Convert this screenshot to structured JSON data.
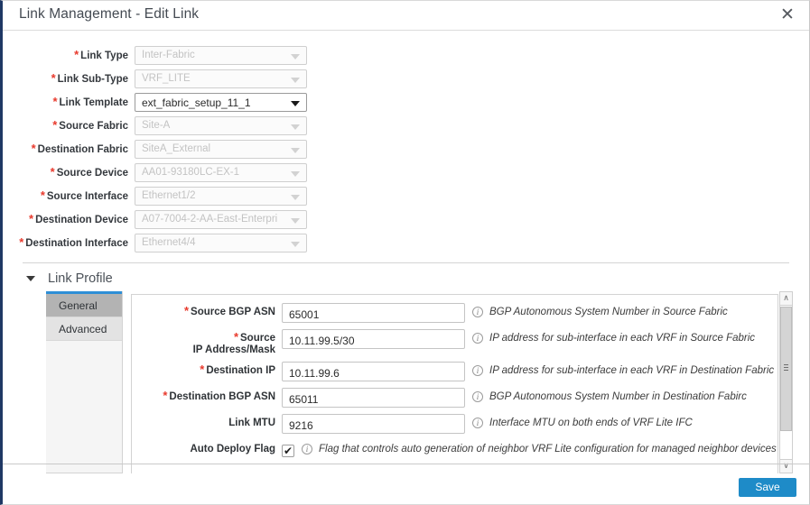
{
  "header": {
    "title": "Link Management - Edit Link",
    "close_label": "✕"
  },
  "top_form": {
    "fields": [
      {
        "label": "Link Type",
        "value": "Inter-Fabric",
        "required": true,
        "enabled": false
      },
      {
        "label": "Link Sub-Type",
        "value": "VRF_LITE",
        "required": true,
        "enabled": false
      },
      {
        "label": "Link Template",
        "value": "ext_fabric_setup_11_1",
        "required": true,
        "enabled": true
      },
      {
        "label": "Source Fabric",
        "value": "Site-A",
        "required": true,
        "enabled": false
      },
      {
        "label": "Destination Fabric",
        "value": "SiteA_External",
        "required": true,
        "enabled": false
      },
      {
        "label": "Source Device",
        "value": "AA01-93180LC-EX-1",
        "required": true,
        "enabled": false
      },
      {
        "label": "Source Interface",
        "value": "Ethernet1/2",
        "required": true,
        "enabled": false
      },
      {
        "label": "Destination Device",
        "value": "A07-7004-2-AA-East-Enterpri",
        "required": true,
        "enabled": false
      },
      {
        "label": "Destination Interface",
        "value": "Ethernet4/4",
        "required": true,
        "enabled": false
      }
    ]
  },
  "link_profile": {
    "title": "Link Profile",
    "tabs": [
      {
        "label": "General",
        "active": true
      },
      {
        "label": "Advanced",
        "active": false
      }
    ],
    "fields": [
      {
        "label_line1": "Source BGP ASN",
        "label_line2": "",
        "required": true,
        "type": "text",
        "value": "65001",
        "help": "BGP Autonomous System Number in Source Fabric"
      },
      {
        "label_line1": "Source",
        "label_line2": "IP Address/Mask",
        "required": true,
        "type": "text",
        "value": "10.11.99.5/30",
        "help": "IP address for sub-interface in each VRF in Source Fabric"
      },
      {
        "label_line1": "Destination IP",
        "label_line2": "",
        "required": true,
        "type": "text",
        "value": "10.11.99.6",
        "help": "IP address for sub-interface in each VRF in Destination Fabric"
      },
      {
        "label_line1": "Destination BGP ASN",
        "label_line2": "",
        "required": true,
        "type": "text",
        "value": "65011",
        "help": "BGP Autonomous System Number in Destination Fabirc"
      },
      {
        "label_line1": "Link MTU",
        "label_line2": "",
        "required": false,
        "type": "text",
        "value": "9216",
        "help": "Interface MTU on both ends of VRF Lite IFC"
      },
      {
        "label_line1": "Auto Deploy Flag",
        "label_line2": "",
        "required": false,
        "type": "checkbox",
        "checked": true,
        "help": "Flag that controls auto generation of neighbor VRF Lite configuration for managed neighbor devices"
      }
    ],
    "scrollbar": {
      "up": "∧",
      "down": "∨"
    }
  },
  "footer": {
    "save_label": "Save"
  },
  "colors": {
    "accent_blue": "#2e8fd6",
    "save_button": "#1e8bc8",
    "required_red": "#e8392c",
    "left_border": "#1f3864"
  }
}
